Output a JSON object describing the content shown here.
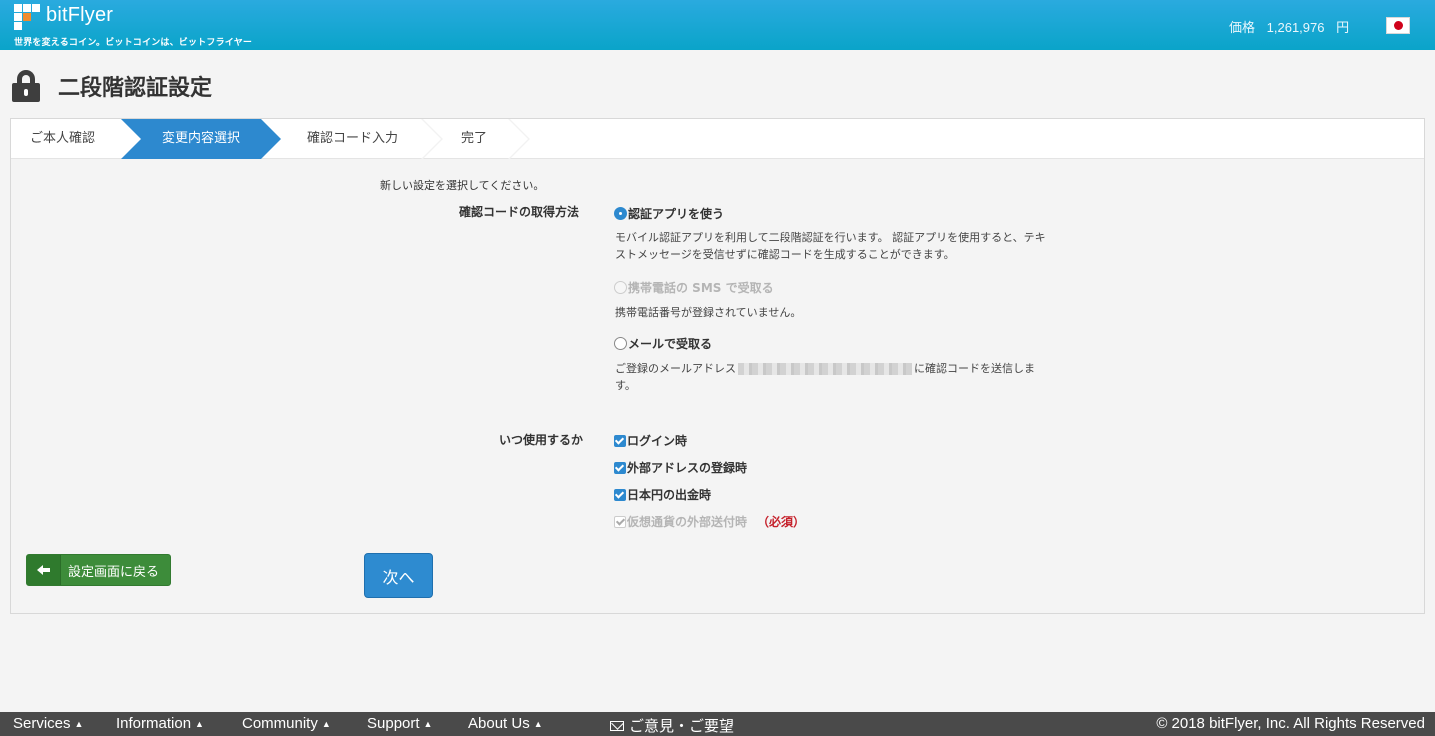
{
  "header": {
    "brand": "bitFlyer",
    "tagline": "世界を変えるコイン。ビットコインは、ビットフライヤー",
    "price_label": "価格",
    "price_value": "1,261,976",
    "price_unit": "円",
    "flag_icon": "japan-flag-icon"
  },
  "page": {
    "title": "二段階認証設定",
    "title_icon": "lock-icon"
  },
  "steps": [
    {
      "label": "ご本人確認",
      "active": false
    },
    {
      "label": "変更内容選択",
      "active": true
    },
    {
      "label": "確認コード入力",
      "active": false
    },
    {
      "label": "完了",
      "active": false
    }
  ],
  "form": {
    "intro": "新しい設定を選択してください。",
    "method_label": "確認コードの取得方法",
    "options": [
      {
        "label": "認証アプリを使う",
        "checked": true,
        "disabled": false,
        "description": "モバイル認証アプリを利用して二段階認証を行います。 認証アプリを使用すると、テキストメッセージを受信せずに確認コードを生成することができます。"
      },
      {
        "label": "携帯電話の SMS で受取る",
        "checked": false,
        "disabled": true,
        "description": "携帯電話番号が登録されていません。"
      },
      {
        "label": "メールで受取る",
        "checked": false,
        "disabled": false,
        "description_prefix": "ご登録のメールアドレス",
        "description_suffix": "に確認コードを送信します。"
      }
    ],
    "when_label": "いつ使用するか",
    "checkboxes": [
      {
        "label": "ログイン時",
        "checked": true,
        "disabled": false
      },
      {
        "label": "外部アドレスの登録時",
        "checked": true,
        "disabled": false
      },
      {
        "label": "日本円の出金時",
        "checked": true,
        "disabled": false
      },
      {
        "label": "仮想通貨の外部送付時",
        "checked": true,
        "disabled": true,
        "note": "（必須）"
      }
    ],
    "back_button": "設定画面に戻る",
    "next_button": "次へ"
  },
  "footer": {
    "nav": [
      {
        "label": "Services",
        "caret": "▲"
      },
      {
        "label": "Information",
        "caret": "▲"
      },
      {
        "label": "Community",
        "caret": "▲"
      },
      {
        "label": "Support",
        "caret": "▲"
      },
      {
        "label": "About Us",
        "caret": "▲"
      }
    ],
    "feedback": "ご意見・ご要望",
    "copyright": "© 2018 bitFlyer, Inc. All Rights Reserved"
  },
  "colors": {
    "header": "#0aa4c9",
    "accent": "#2d89cf",
    "back_button": "#3d8c3a",
    "required": "#c5202a",
    "footer": "#4a4a4a"
  }
}
